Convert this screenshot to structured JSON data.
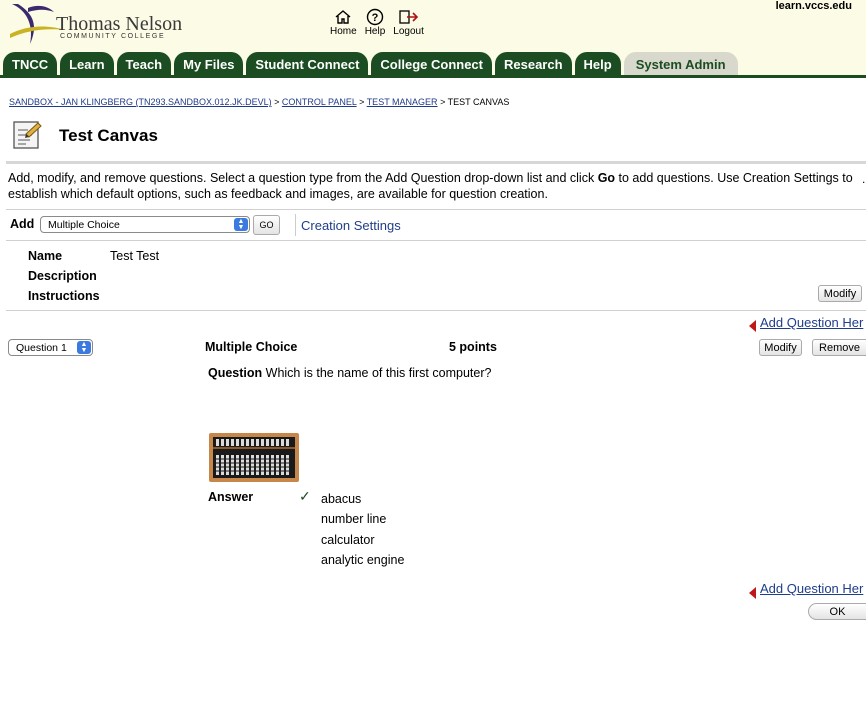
{
  "header": {
    "logo_name": "Thomas Nelson",
    "logo_sub": "COMMUNITY COLLEGE",
    "site_url": "learn.vccs.edu",
    "util_nav": [
      {
        "label": "Home",
        "icon": "home-icon"
      },
      {
        "label": "Help",
        "icon": "help-icon"
      },
      {
        "label": "Logout",
        "icon": "logout-icon"
      }
    ]
  },
  "tabs": [
    {
      "label": "TNCC"
    },
    {
      "label": "Learn"
    },
    {
      "label": "Teach"
    },
    {
      "label": "My Files"
    },
    {
      "label": "Student Connect"
    },
    {
      "label": "College Connect"
    },
    {
      "label": "Research"
    },
    {
      "label": "Help"
    },
    {
      "label": "System Admin",
      "active": true
    }
  ],
  "breadcrumb": {
    "items": [
      "SANDBOX - JAN KLINGBERG (TN293.SANDBOX.012.JK.DEVL)",
      "CONTROL PANEL",
      "TEST MANAGER"
    ],
    "current": "TEST CANVAS",
    "separator": ">"
  },
  "page": {
    "title": "Test Canvas",
    "intro_part1": "Add, modify, and remove questions. Select a question type from the Add Question drop-down list and click ",
    "intro_bold": "Go",
    "intro_part2": " to add questions. Use Creation Settings to establish which default options, such as feedback and images, are available for question creation.",
    "intro_mark": "."
  },
  "add_row": {
    "label": "Add",
    "question_type": "Multiple Choice",
    "go_label": "GO",
    "creation_settings": "Creation Settings"
  },
  "test_info": {
    "name_label": "Name",
    "name_value": "Test Test",
    "description_label": "Description",
    "instructions_label": "Instructions",
    "modify_label": "Modify"
  },
  "add_question_here": "Add Question Her",
  "question": {
    "selector": "Question 1",
    "type": "Multiple Choice",
    "points": "5 points",
    "modify_label": "Modify",
    "remove_label": "Remove",
    "question_label": "Question",
    "text": "Which is the name of this first computer?",
    "image_icon": "abacus-image",
    "answer_label": "Answer",
    "choices": [
      "abacus",
      "number line",
      "calculator",
      "analytic engine"
    ],
    "correct_index": 0
  },
  "ok_label": "OK",
  "colors": {
    "tab_bg": "#1c4d22",
    "header_bg": "#fbfbe6",
    "link": "#1f3d8a",
    "arrow_red": "#c01818"
  }
}
